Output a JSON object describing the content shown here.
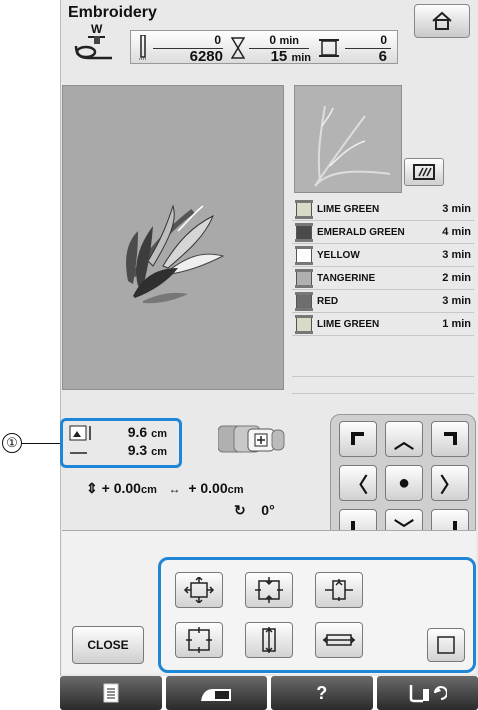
{
  "header": {
    "title": "Embroidery",
    "spool_label": "W"
  },
  "counters": {
    "stitch_current": "0",
    "stitch_total": "6280",
    "time_current": "0",
    "time_total": "15",
    "time_unit": "min",
    "color_current": "0",
    "color_total": "6"
  },
  "colors": [
    {
      "name": "LIME GREEN",
      "time": "3 min",
      "hex": "#d9dbc6"
    },
    {
      "name": "EMERALD GREEN",
      "time": "4 min",
      "hex": "#4a4a4a"
    },
    {
      "name": "YELLOW",
      "time": "3 min",
      "hex": "#ffffff"
    },
    {
      "name": "TANGERINE",
      "time": "2 min",
      "hex": "#b0b0b0"
    },
    {
      "name": "RED",
      "time": "3 min",
      "hex": "#6e6e6e"
    },
    {
      "name": "LIME GREEN",
      "time": "1 min",
      "hex": "#d9dbc6"
    }
  ],
  "size": {
    "height": "9.6",
    "width": "9.3",
    "unit": "cm"
  },
  "callout": "①",
  "position": {
    "y_value": "+ 0.00",
    "x_value": "+ 0.00",
    "unit": "cm",
    "rotation": "0°"
  },
  "buttons": {
    "close": "CLOSE"
  },
  "taskbar": {
    "help": "?"
  }
}
